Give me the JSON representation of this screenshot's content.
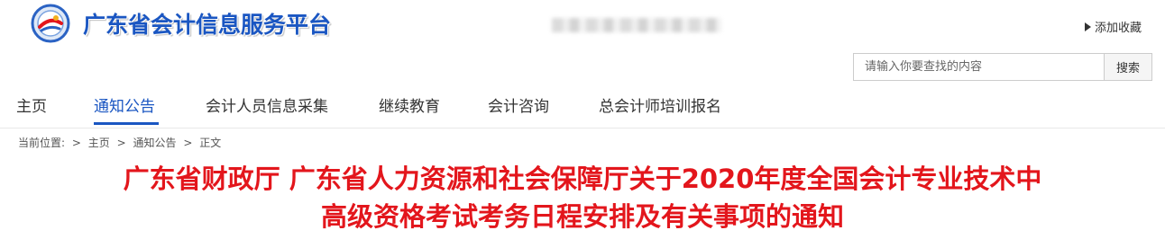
{
  "header": {
    "site_title": "广东省会计信息服务平台",
    "favorite_label": "添加收藏"
  },
  "search": {
    "placeholder": "请输入你要查找的内容",
    "button_label": "搜索"
  },
  "nav": {
    "items": [
      {
        "label": "主页"
      },
      {
        "label": "通知公告",
        "active": true
      },
      {
        "label": "会计人员信息采集"
      },
      {
        "label": "继续教育"
      },
      {
        "label": "会计咨询"
      },
      {
        "label": "总会计师培训报名"
      }
    ],
    "accent_color": "#1a56c2"
  },
  "breadcrumb": {
    "prefix": "当前位置:",
    "sep": ">",
    "items": [
      "主页",
      "通知公告",
      "正文"
    ]
  },
  "article": {
    "title_line1": "广东省财政厅 广东省人力资源和社会保障厅关于2020年度全国会计专业技术中",
    "title_line2": "高级资格考试考务日程安排及有关事项的通知",
    "title_color": "#e3161c"
  }
}
